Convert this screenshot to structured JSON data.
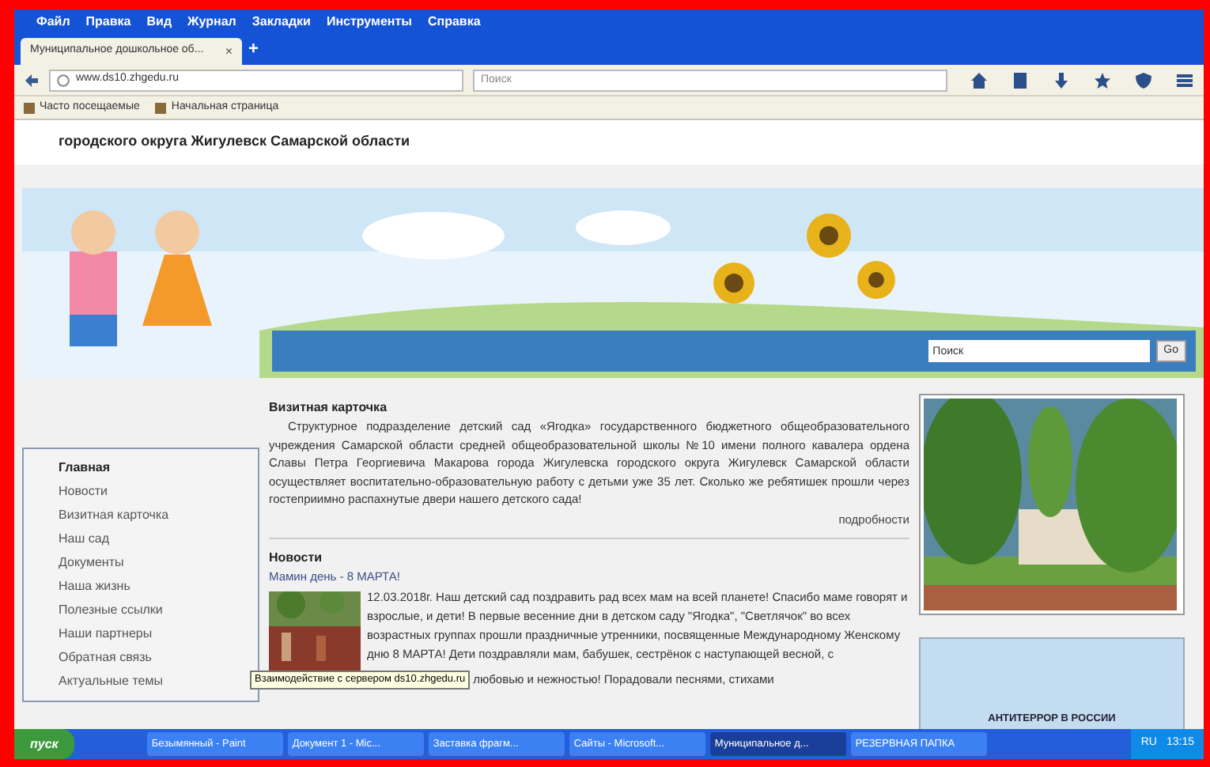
{
  "browser": {
    "menu": [
      "Файл",
      "Правка",
      "Вид",
      "Журнал",
      "Закладки",
      "Инструменты",
      "Справка"
    ],
    "tab": {
      "title": "Муниципальное дошкольное об...",
      "close": "×"
    },
    "new_tab": "+",
    "address": "www.ds10.zhgedu.ru",
    "search": {
      "placeholder": "Поиск"
    },
    "bookmarks": [
      "Часто посещаемые",
      "Начальная страница"
    ]
  },
  "site": {
    "header_text": "городского округа Жигулевск Самарской области",
    "search": {
      "value": "Поиск",
      "button": "Go"
    },
    "nav": [
      {
        "label": "Главная",
        "selected": true
      },
      {
        "label": "Новости",
        "selected": false
      },
      {
        "label": "Визитная карточка",
        "selected": false
      },
      {
        "label": "Наш сад",
        "selected": false
      },
      {
        "label": "Документы",
        "selected": false
      },
      {
        "label": "Наша жизнь",
        "selected": false
      },
      {
        "label": "Полезные ссылки",
        "selected": false
      },
      {
        "label": "Наши партнеры",
        "selected": false
      },
      {
        "label": "Обратная связь",
        "selected": false
      },
      {
        "label": "Актуальные темы",
        "selected": false
      }
    ],
    "card": {
      "title": "Визитная карточка",
      "text": "Структурное подразделение детский сад «Ягодка» государственного бюджетного общеобразовательного учреждения Самарской области средней общеобразовательной школы №10 имени полного кавалера ордена Славы Петра Георгиевича Макарова города Жигулевска городского округа Жигулевск Самарской области осуществляет воспитательно-образовательную работу с детьми уже 35 лет. Сколько же ребятишек прошли через гостеприимно распахнутые двери нашего детского сада!",
      "more": "подробности"
    },
    "news": {
      "title": "Новости",
      "items": [
        {
          "title": "Мамин день - 8 МАРТА!",
          "text": "12.03.2018г. Наш детский сад поздравить рад всех мам на всей планете! Спасибо маме говорят и взрослые, и дети! В первые весенние дни в детском саду \"Ягодка\", \"Светлячок\" во всех возрастных группах прошли праздничные утренники, посвященные Международному Женскому дню 8 МАРТА! Дети поздравляли мам, бабушек, сестрёнок с наступающей весной, с",
          "last_line": "любовью и нежностью! Порадовали песнями, стихами"
        }
      ]
    },
    "side_box": "АНТИТЕРРОР В РОССИИ"
  },
  "tooltip": "Взаимодействие с сервером ds10.zhgedu.ru",
  "taskbar": {
    "start": "пуск",
    "tasks": [
      {
        "label": "Безымянный - Paint",
        "selected": false
      },
      {
        "label": "Документ 1 - Mic...",
        "selected": false
      },
      {
        "label": "Заставка фрагм...",
        "selected": false
      },
      {
        "label": "Сайты - Microsoft...",
        "selected": false
      },
      {
        "label": "Муниципальное д...",
        "selected": true
      },
      {
        "label": "РЕЗЕРВНАЯ ПАПКА",
        "selected": false
      }
    ],
    "lang": "RU",
    "time": "13:15"
  }
}
